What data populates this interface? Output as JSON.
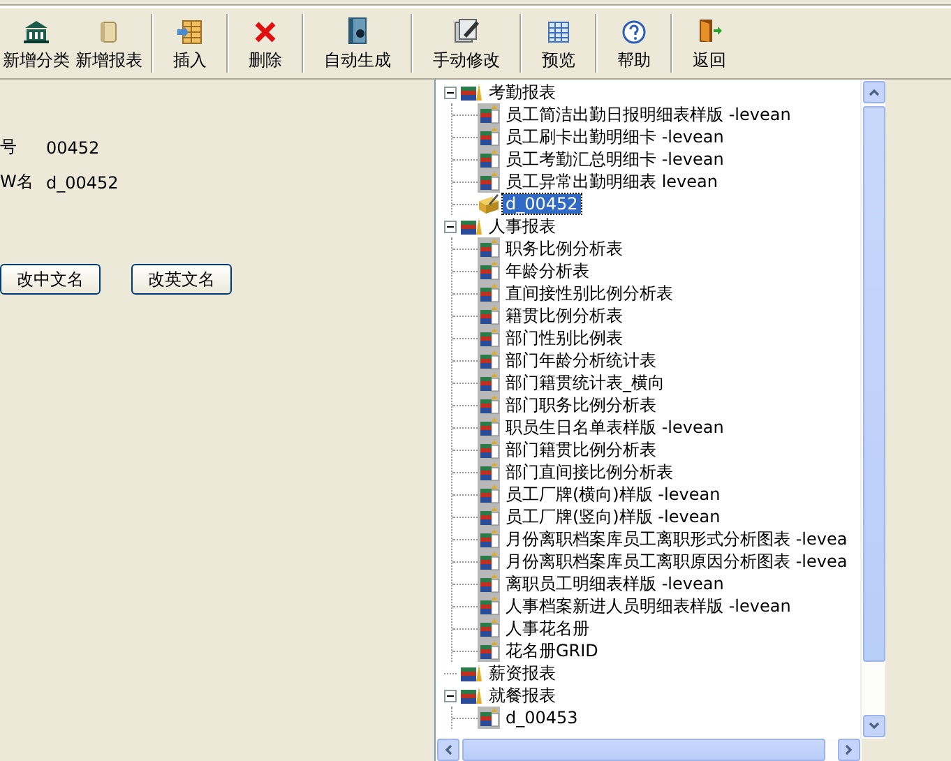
{
  "toolbar": [
    {
      "label": "新增分类"
    },
    {
      "label": "新增报表"
    },
    {
      "label": "插入"
    },
    {
      "label": "删除"
    },
    {
      "label": "自动生成"
    },
    {
      "label": "手动修改"
    },
    {
      "label": "预览"
    },
    {
      "label": "帮助"
    },
    {
      "label": "返回"
    }
  ],
  "details": {
    "fields": [
      {
        "label": "号",
        "value": "00452"
      },
      {
        "label": "W名",
        "value": "d_00452"
      }
    ],
    "buttons": [
      "改中文名",
      "改英文名"
    ]
  },
  "tree": [
    {
      "label": "考勤报表",
      "expanded": true,
      "children": [
        {
          "label": "员工简洁出勤日报明细表样版 -levean",
          "kind": "report",
          "selected": false
        },
        {
          "label": "员工刷卡出勤明细卡 -levean",
          "kind": "report",
          "selected": false
        },
        {
          "label": "员工考勤汇总明细卡 -levean",
          "kind": "report",
          "selected": false
        },
        {
          "label": "员工异常出勤明细表 levean",
          "kind": "report",
          "selected": false
        },
        {
          "label": "d_00452",
          "kind": "draft",
          "selected": true
        }
      ]
    },
    {
      "label": "人事报表",
      "expanded": true,
      "children": [
        {
          "label": "职务比例分析表",
          "kind": "report",
          "selected": false
        },
        {
          "label": "年龄分析表",
          "kind": "report",
          "selected": false
        },
        {
          "label": "直间接性别比例分析表",
          "kind": "report",
          "selected": false
        },
        {
          "label": "籍贯比例分析表",
          "kind": "report",
          "selected": false
        },
        {
          "label": "部门性别比例表",
          "kind": "report",
          "selected": false
        },
        {
          "label": "部门年龄分析统计表",
          "kind": "report",
          "selected": false
        },
        {
          "label": "部门籍贯统计表_横向",
          "kind": "report",
          "selected": false
        },
        {
          "label": "部门职务比例分析表",
          "kind": "report",
          "selected": false
        },
        {
          "label": "职员生日名单表样版 -levean",
          "kind": "report",
          "selected": false
        },
        {
          "label": "部门籍贯比例分析表",
          "kind": "report",
          "selected": false
        },
        {
          "label": "部门直间接比例分析表",
          "kind": "report",
          "selected": false
        },
        {
          "label": "员工厂牌(横向)样版 -levean",
          "kind": "report",
          "selected": false
        },
        {
          "label": "员工厂牌(竖向)样版 -levean",
          "kind": "report",
          "selected": false
        },
        {
          "label": "月份离职档案库员工离职形式分析图表 -levea",
          "kind": "report",
          "selected": false
        },
        {
          "label": "月份离职档案库员工离职原因分析图表 -levea",
          "kind": "report",
          "selected": false
        },
        {
          "label": "离职员工明细表样版 -levean",
          "kind": "report",
          "selected": false
        },
        {
          "label": "人事档案新进人员明细表样版 -levean",
          "kind": "report",
          "selected": false
        },
        {
          "label": "人事花名册",
          "kind": "report",
          "selected": false
        },
        {
          "label": "花名册GRID",
          "kind": "report",
          "selected": false
        }
      ]
    },
    {
      "label": "薪资报表",
      "expanded": false
    },
    {
      "label": "就餐报表",
      "expanded": true,
      "children": [
        {
          "label": "d_00453",
          "kind": "report",
          "selected": false
        }
      ]
    }
  ]
}
